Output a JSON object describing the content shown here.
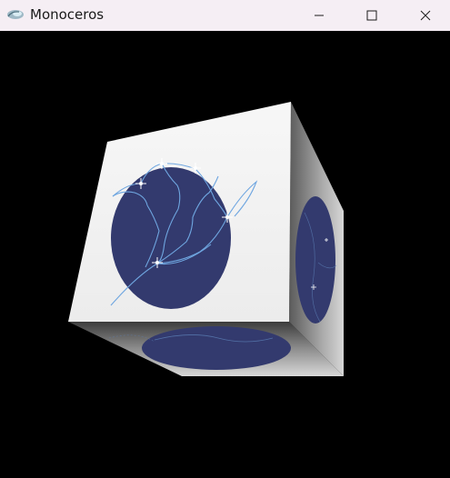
{
  "window": {
    "title": "Monoceros",
    "app_icon": "monoceros-app-icon",
    "controls": {
      "minimize_icon": "minimize-icon",
      "maximize_icon": "maximize-icon",
      "close_icon": "close-icon"
    }
  },
  "scene": {
    "object": "rotating-cube",
    "background_color": "#000000",
    "face_color": "#f4f4f4",
    "emblem_color": "#333a6e",
    "constellation_line_color": "#6fa6e0",
    "star_color": "#ffffff"
  }
}
